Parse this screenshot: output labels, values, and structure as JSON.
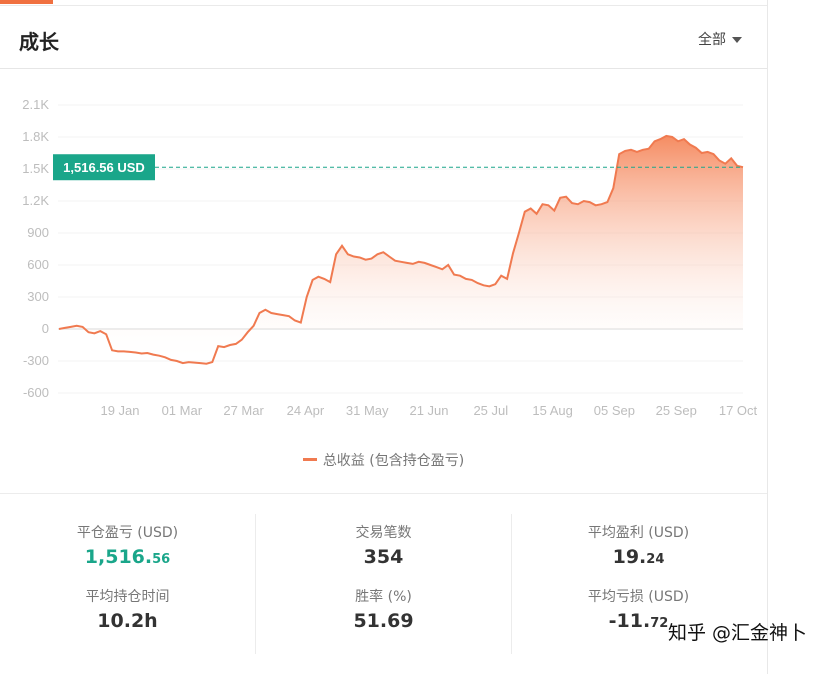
{
  "header": {
    "title": "成长",
    "filter_label": "全部"
  },
  "chart_data": {
    "type": "area",
    "series": [
      {
        "name": "总收益 (包含持仓盈亏)"
      }
    ],
    "y_ticks": [
      "2.1K",
      "1.8K",
      "1.5K",
      "1.2K",
      "900",
      "600",
      "300",
      "0",
      "-300",
      "-600"
    ],
    "x_ticks": [
      "19 Jan",
      "01 Mar",
      "27 Mar",
      "24 Apr",
      "31 May",
      "21 Jun",
      "25 Jul",
      "15 Aug",
      "05 Sep",
      "25 Sep",
      "17 Oct"
    ],
    "ylim": [
      -600,
      2100
    ],
    "current_value_label": "1,516.56 USD",
    "current_value": 1516.56,
    "values": [
      0,
      10,
      20,
      30,
      20,
      -30,
      -40,
      -20,
      -50,
      -200,
      -210,
      -210,
      -215,
      -220,
      -230,
      -225,
      -240,
      -250,
      -265,
      -290,
      -300,
      -320,
      -310,
      -315,
      -320,
      -325,
      -310,
      -160,
      -170,
      -150,
      -140,
      -100,
      -30,
      30,
      150,
      180,
      150,
      140,
      130,
      120,
      80,
      60,
      300,
      460,
      490,
      470,
      440,
      700,
      780,
      700,
      680,
      670,
      650,
      660,
      700,
      720,
      680,
      640,
      630,
      620,
      610,
      630,
      620,
      600,
      580,
      560,
      600,
      510,
      500,
      470,
      460,
      430,
      410,
      400,
      420,
      500,
      470,
      710,
      900,
      1100,
      1130,
      1080,
      1170,
      1160,
      1110,
      1230,
      1240,
      1180,
      1170,
      1200,
      1190,
      1160,
      1170,
      1190,
      1320,
      1640,
      1670,
      1680,
      1660,
      1680,
      1690,
      1760,
      1780,
      1810,
      1800,
      1760,
      1780,
      1730,
      1700,
      1650,
      1660,
      1640,
      1580,
      1550,
      1600,
      1530,
      1516.56
    ],
    "legend_label": "总收益 (包含持仓盈亏)",
    "colors": {
      "line": "#f07a50",
      "area_top": "#f5865a",
      "area_bottom": "#ffffff",
      "marker": "#1aa68a"
    }
  },
  "stats": {
    "closed_pnl": {
      "label": "平仓盈亏 (USD)",
      "value_main": "1,516.",
      "value_small": "56"
    },
    "trade_count": {
      "label": "交易笔数",
      "value": "354"
    },
    "avg_profit": {
      "label": "平均盈利 (USD)",
      "value_main": "19.",
      "value_small": "24"
    },
    "avg_hold_time": {
      "label": "平均持仓时间",
      "value": "10.2h"
    },
    "win_rate": {
      "label": "胜率 (%)",
      "value": "51.69"
    },
    "avg_loss": {
      "label": "平均亏损 (USD)",
      "value_main": "-11.",
      "value_small": "72"
    }
  },
  "watermark": "知乎 @汇金神卜"
}
